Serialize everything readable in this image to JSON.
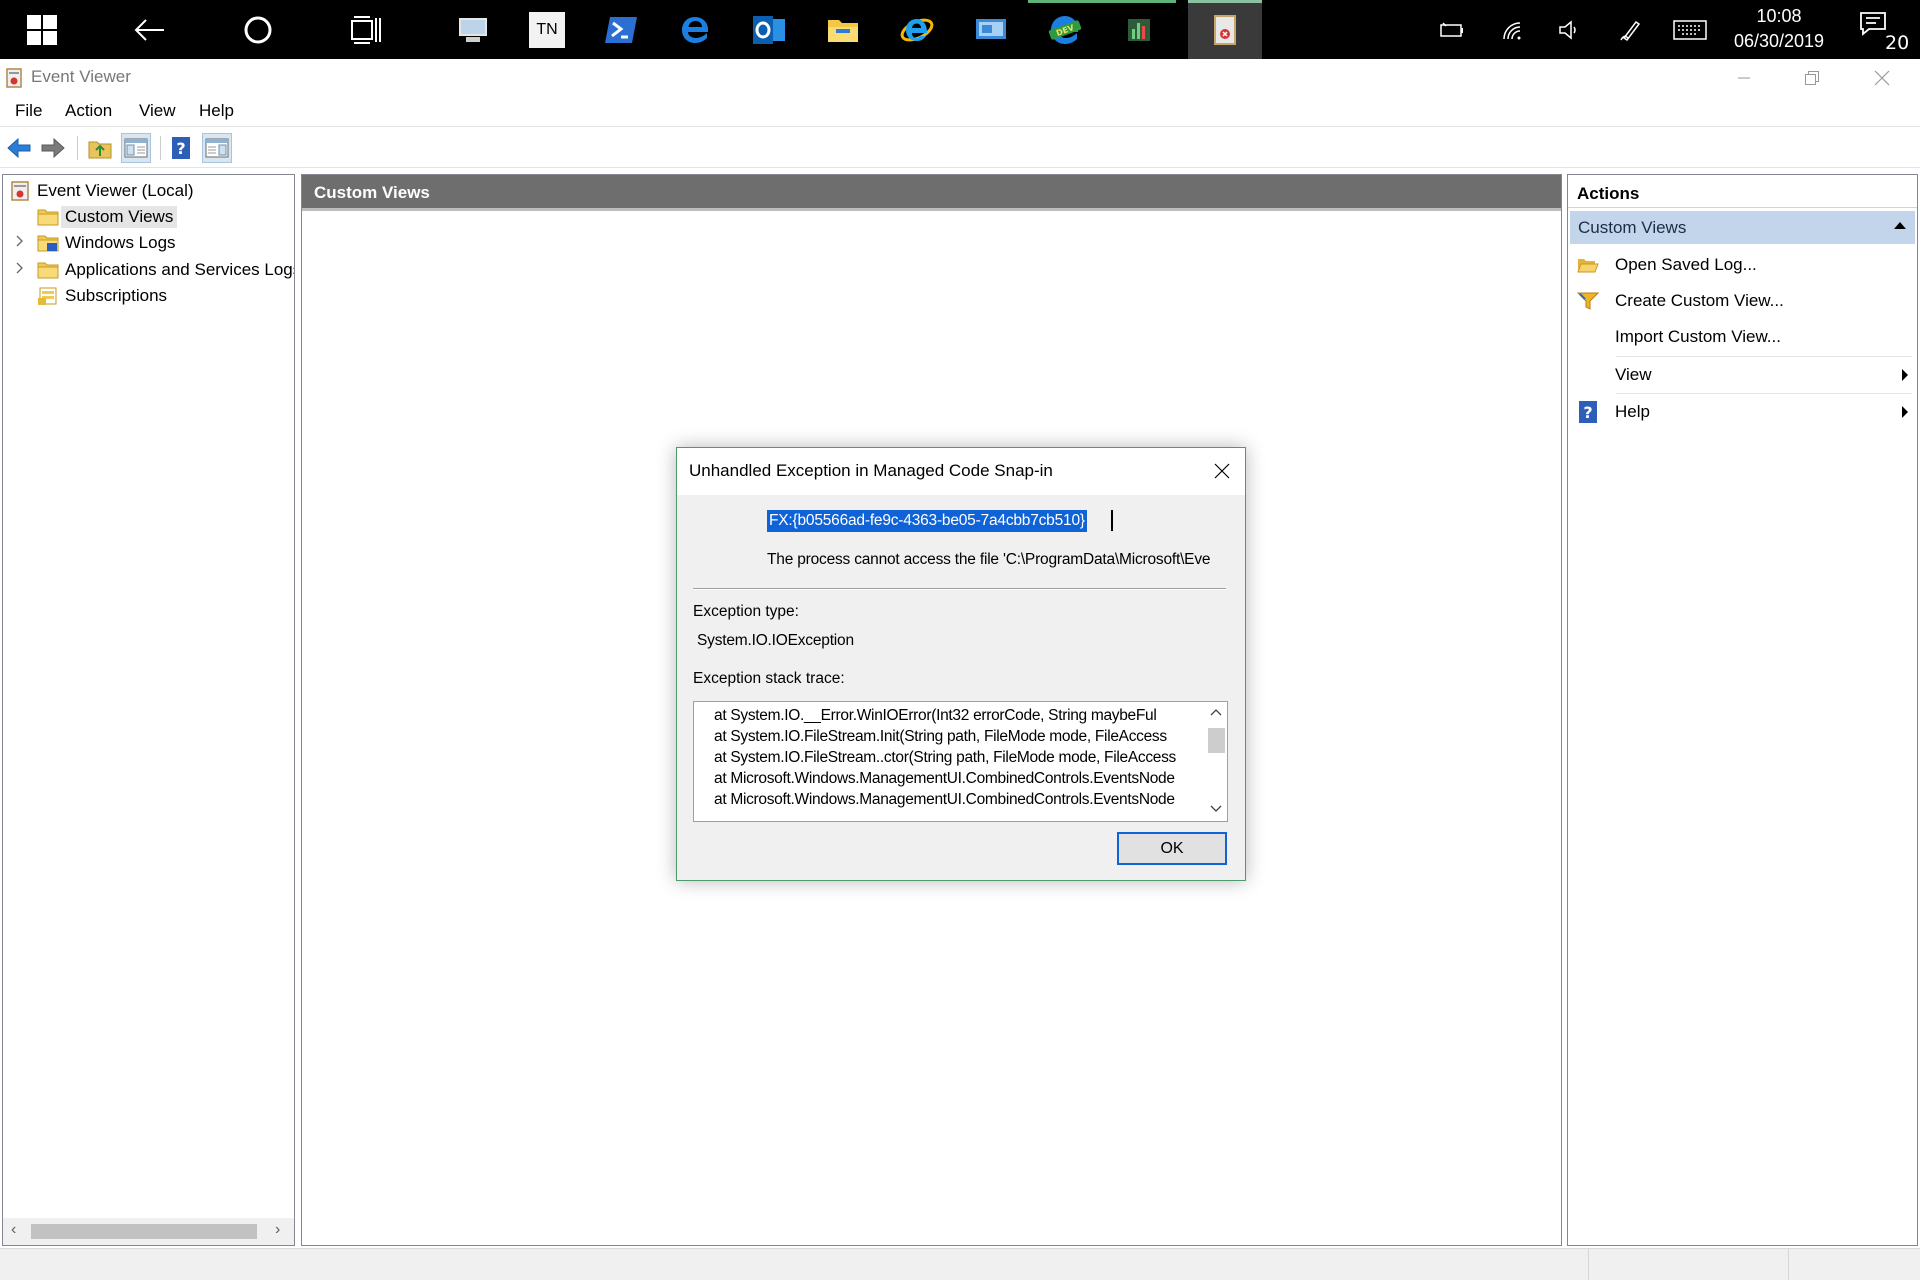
{
  "taskbar": {
    "clock_time": "10:08",
    "clock_date": "06/30/2019",
    "notification_count": "20",
    "tn_label": "TN"
  },
  "window": {
    "title": "Event Viewer"
  },
  "menu": {
    "file": "File",
    "action": "Action",
    "view": "View",
    "help": "Help"
  },
  "tree": {
    "root": "Event Viewer (Local)",
    "items": [
      {
        "label": "Custom Views"
      },
      {
        "label": "Windows Logs"
      },
      {
        "label": "Applications and Services Logs"
      },
      {
        "label": "Subscriptions"
      }
    ]
  },
  "center": {
    "header": "Custom Views"
  },
  "actions": {
    "header": "Actions",
    "section": "Custom Views",
    "items": [
      {
        "label": "Open Saved Log..."
      },
      {
        "label": "Create Custom View..."
      },
      {
        "label": "Import Custom View..."
      },
      {
        "label": "View"
      },
      {
        "label": "Help"
      }
    ]
  },
  "dialog": {
    "title": "Unhandled Exception in Managed Code Snap-in",
    "id": "FX:{b05566ad-fe9c-4363-be05-7a4cbb7cb510}",
    "message": "The process cannot access the file 'C:\\ProgramData\\Microsoft\\Eve",
    "exception_type_label": "Exception type:",
    "exception_type": "System.IO.IOException",
    "stack_trace_label": "Exception stack trace:",
    "stack_trace": [
      "at System.IO.__Error.WinIOError(Int32 errorCode, String maybeFul",
      "at System.IO.FileStream.Init(String path, FileMode mode, FileAccess",
      "at System.IO.FileStream..ctor(String path, FileMode mode, FileAccess",
      "at Microsoft.Windows.ManagementUI.CombinedControls.EventsNode",
      "at Microsoft.Windows.ManagementUI.CombinedControls.EventsNode"
    ],
    "ok_label": "OK"
  },
  "colors": {
    "selection_blue": "#0f63d6",
    "pane_header_gray": "#6e6e6e",
    "actions_section_blue": "#c3d5ea",
    "dialog_border_green": "#4e9a6b"
  }
}
